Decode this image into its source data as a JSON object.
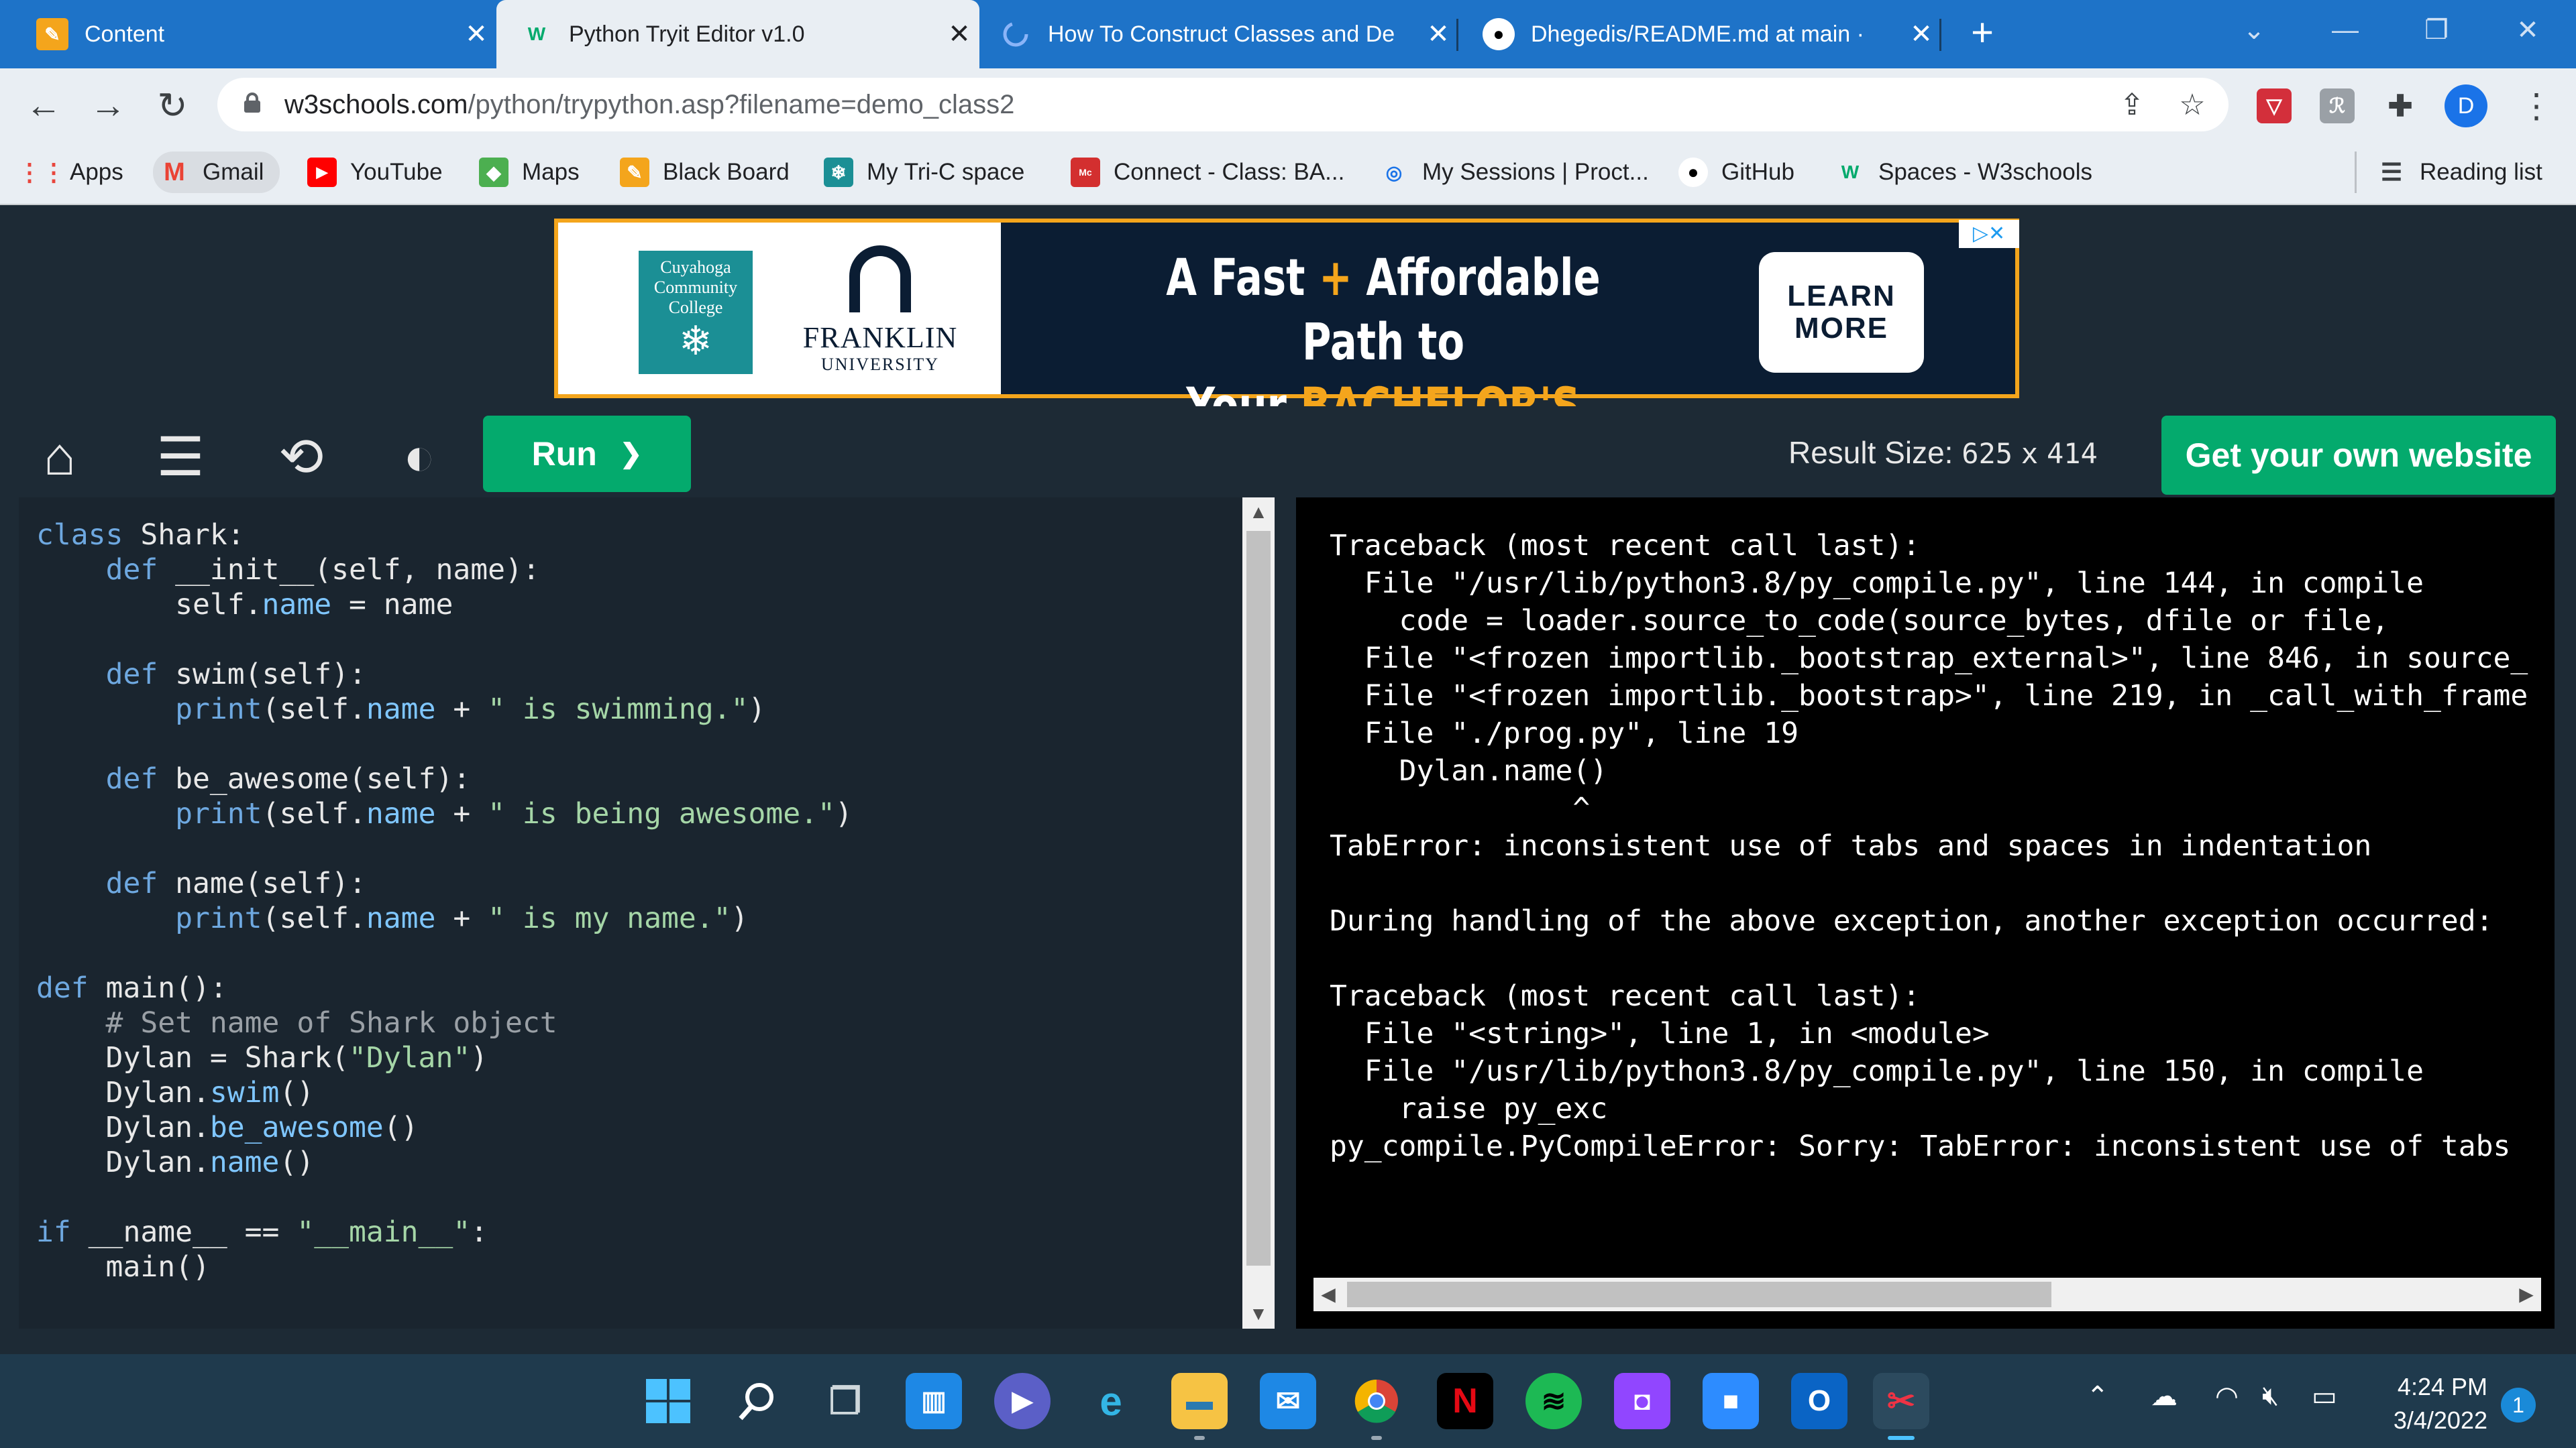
{
  "browser": {
    "tabs": [
      {
        "title": "Content",
        "icon": "pencil-icon"
      },
      {
        "title": "Python Tryit Editor v1.0",
        "icon": "w3schools-icon"
      },
      {
        "title": "How To Construct Classes and De",
        "icon": "loading-icon"
      },
      {
        "title": "Dhegedis/README.md at main · ",
        "icon": "github-icon"
      }
    ],
    "new_tab": "+",
    "url_domain": "w3schools.com",
    "url_path": "/python/trypython.asp?filename=demo_class2",
    "profile_initial": "D"
  },
  "bookmarks": [
    "Apps",
    "Gmail",
    "YouTube",
    "Maps",
    "Black Board",
    "My Tri-C space",
    "Connect - Class: BA...",
    "My Sessions | Proct...",
    "GitHub",
    "Spaces - W3schools"
  ],
  "reading_list": "Reading list",
  "ad": {
    "ccc_lines": [
      "Cuyahoga",
      "Community",
      "College"
    ],
    "franklin_name": "FRANKLIN",
    "franklin_sub": "UNIVERSITY",
    "headline_1a": "A Fast ",
    "headline_1b": "+",
    "headline_1c": " Affordable Path to",
    "headline_2a": "Your ",
    "headline_2b": "BACHELOR'S DEGREE",
    "cta_line1": "LEARN",
    "cta_line2": "MORE"
  },
  "toolbar": {
    "run_label": "Run",
    "run_chevron": "❯",
    "result_size_label": "Result Size:",
    "result_width": "625",
    "result_x": "x",
    "result_height": "414",
    "get_website_label": "Get your own website"
  },
  "editor": {
    "lines": [
      [
        {
          "t": "class",
          "c": "k"
        },
        {
          "t": " Shark:",
          "c": ""
        }
      ],
      [
        {
          "t": "    ",
          "c": ""
        },
        {
          "t": "def",
          "c": "k"
        },
        {
          "t": " __init__(self, name):",
          "c": ""
        }
      ],
      [
        {
          "t": "        self.",
          "c": ""
        },
        {
          "t": "name",
          "c": "p"
        },
        {
          "t": " = name",
          "c": ""
        }
      ],
      [],
      [
        {
          "t": "    ",
          "c": ""
        },
        {
          "t": "def",
          "c": "k"
        },
        {
          "t": " swim(self):",
          "c": ""
        }
      ],
      [
        {
          "t": "        ",
          "c": ""
        },
        {
          "t": "print",
          "c": "k"
        },
        {
          "t": "(self.",
          "c": ""
        },
        {
          "t": "name",
          "c": "p"
        },
        {
          "t": " + ",
          "c": ""
        },
        {
          "t": "\" is swimming.\"",
          "c": "s"
        },
        {
          "t": ")",
          "c": ""
        }
      ],
      [],
      [
        {
          "t": "    ",
          "c": ""
        },
        {
          "t": "def",
          "c": "k"
        },
        {
          "t": " be_awesome(self):",
          "c": ""
        }
      ],
      [
        {
          "t": "        ",
          "c": ""
        },
        {
          "t": "print",
          "c": "k"
        },
        {
          "t": "(self.",
          "c": ""
        },
        {
          "t": "name",
          "c": "p"
        },
        {
          "t": " + ",
          "c": ""
        },
        {
          "t": "\" is being awesome.\"",
          "c": "s"
        },
        {
          "t": ")",
          "c": ""
        }
      ],
      [],
      [
        {
          "t": "    ",
          "c": ""
        },
        {
          "t": "def",
          "c": "k"
        },
        {
          "t": " name(self):",
          "c": ""
        }
      ],
      [
        {
          "t": "        ",
          "c": ""
        },
        {
          "t": "print",
          "c": "k"
        },
        {
          "t": "(self.",
          "c": ""
        },
        {
          "t": "name",
          "c": "p"
        },
        {
          "t": " + ",
          "c": ""
        },
        {
          "t": "\" is my name.\"",
          "c": "s"
        },
        {
          "t": ")",
          "c": ""
        }
      ],
      [],
      [
        {
          "t": "def",
          "c": "k"
        },
        {
          "t": " main():",
          "c": ""
        }
      ],
      [
        {
          "t": "    # Set name of Shark object",
          "c": "c"
        }
      ],
      [
        {
          "t": "    Dylan = Shark(",
          "c": ""
        },
        {
          "t": "\"Dylan\"",
          "c": "s"
        },
        {
          "t": ")",
          "c": ""
        }
      ],
      [
        {
          "t": "    Dylan.",
          "c": ""
        },
        {
          "t": "swim",
          "c": "p"
        },
        {
          "t": "()",
          "c": ""
        }
      ],
      [
        {
          "t": "    Dylan.",
          "c": ""
        },
        {
          "t": "be_awesome",
          "c": "p"
        },
        {
          "t": "()",
          "c": ""
        }
      ],
      [
        {
          "t": "    Dylan.",
          "c": ""
        },
        {
          "t": "name",
          "c": "p"
        },
        {
          "t": "()",
          "c": ""
        }
      ],
      [],
      [
        {
          "t": "if",
          "c": "k"
        },
        {
          "t": " __name__ == ",
          "c": ""
        },
        {
          "t": "\"__main__\"",
          "c": "s"
        },
        {
          "t": ":",
          "c": ""
        }
      ],
      [
        {
          "t": "    main()",
          "c": ""
        }
      ]
    ]
  },
  "output": {
    "lines": [
      "Traceback (most recent call last):",
      "  File \"/usr/lib/python3.8/py_compile.py\", line 144, in compile",
      "    code = loader.source_to_code(source_bytes, dfile or file,",
      "  File \"<frozen importlib._bootstrap_external>\", line 846, in source_",
      "  File \"<frozen importlib._bootstrap>\", line 219, in _call_with_frame",
      "  File \"./prog.py\", line 19",
      "    Dylan.name()",
      "              ^",
      "TabError: inconsistent use of tabs and spaces in indentation",
      "",
      "During handling of the above exception, another exception occurred:",
      "",
      "Traceback (most recent call last):",
      "  File \"<string>\", line 1, in <module>",
      "  File \"/usr/lib/python3.8/py_compile.py\", line 150, in compile",
      "    raise py_exc",
      "py_compile.PyCompileError: Sorry: TabError: inconsistent use of tabs"
    ]
  },
  "taskbar": {
    "clock_time": "4:24 PM",
    "clock_date": "3/4/2022",
    "notification_count": "1"
  }
}
